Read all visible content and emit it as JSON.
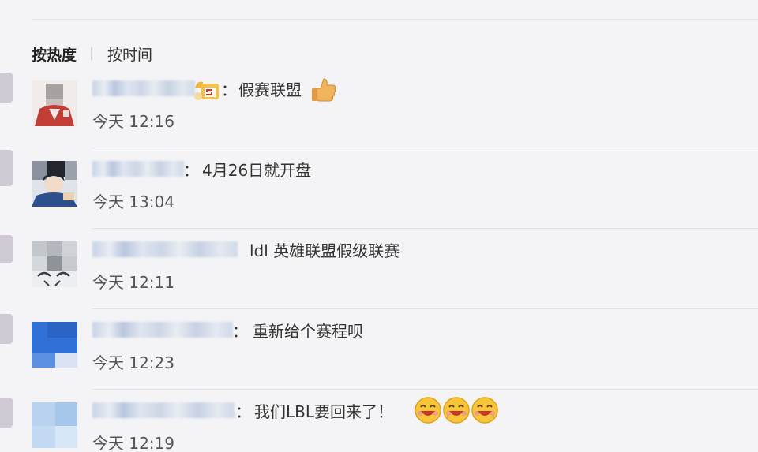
{
  "sort": {
    "hot": "按热度",
    "time": "按时间"
  },
  "comments": [
    {
      "text": "假赛联盟",
      "time": "今天 12:16",
      "emoji": [
        "thumbs-up-icon"
      ]
    },
    {
      "text": "4月26日就开盘",
      "time": "今天 13:04"
    },
    {
      "text": "ldl 英雄联盟假级联赛",
      "time": "今天 12:11"
    },
    {
      "text": "重新给个赛程呗",
      "time": "今天 12:23"
    },
    {
      "text": "我们LBL要回来了！",
      "time": "今天 12:19",
      "emoji": [
        "grin-icon",
        "grin-icon",
        "grin-icon"
      ]
    }
  ],
  "colors": {
    "text": "#333333",
    "time": "#555555",
    "divider": "#e2e2e6",
    "background": "#f4f4f6"
  }
}
